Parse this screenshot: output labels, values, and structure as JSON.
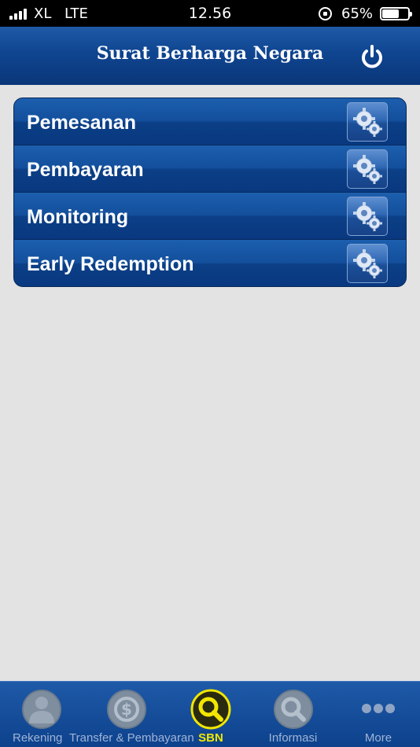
{
  "status_bar": {
    "carrier": "XL",
    "network": "LTE",
    "time": "12.56",
    "battery_percent": "65%",
    "battery_level": 0.65
  },
  "header": {
    "title": "Surat Berharga Negara",
    "power_icon": "power-icon"
  },
  "menu": {
    "items": [
      {
        "label": "Pemesanan",
        "icon": "gears-icon"
      },
      {
        "label": "Pembayaran",
        "icon": "gears-icon"
      },
      {
        "label": "Monitoring",
        "icon": "gears-icon"
      },
      {
        "label": "Early Redemption",
        "icon": "gears-icon"
      }
    ]
  },
  "tab_bar": {
    "tabs": [
      {
        "label": "Rekening",
        "icon": "person-icon",
        "active": false
      },
      {
        "label": "Transfer & Pembayaran",
        "icon": "money-transfer-icon",
        "active": false
      },
      {
        "label": "SBN",
        "icon": "magnifier-icon",
        "active": true
      },
      {
        "label": "Informasi",
        "icon": "magnifier-icon",
        "active": false
      },
      {
        "label": "More",
        "icon": "more-dots-icon",
        "active": false
      }
    ],
    "active_color": "#f2e600",
    "inactive_color": "#9fb4d6"
  },
  "colors": {
    "header_blue": "#0f4590",
    "background": "#e3e3e3"
  }
}
